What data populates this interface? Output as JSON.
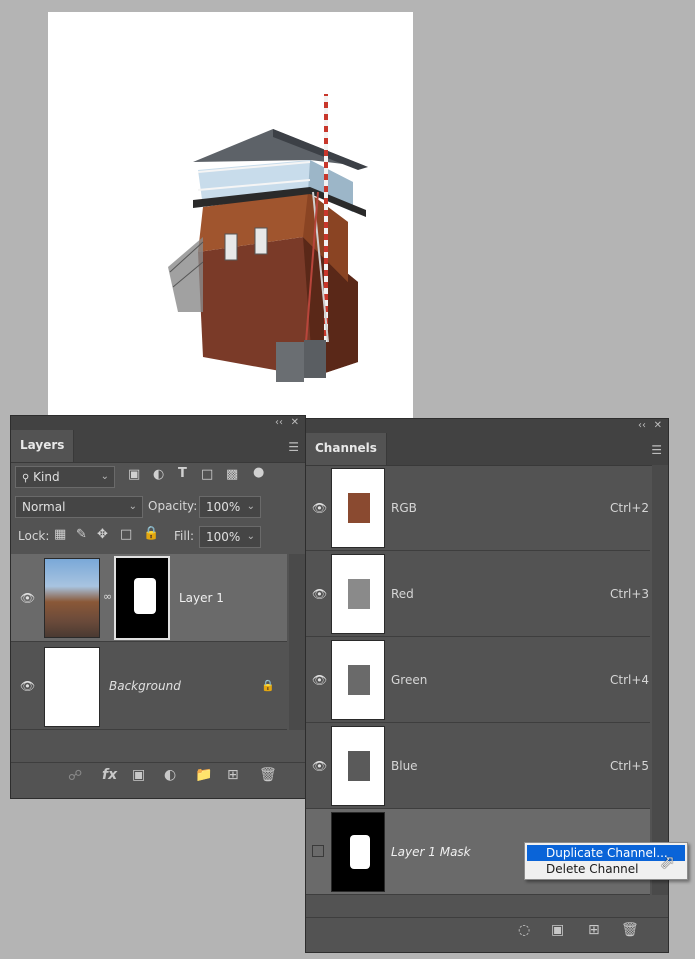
{
  "layers_panel": {
    "tab": "Layers",
    "filter_kind": "Kind",
    "blend_mode": "Normal",
    "opacity_label": "Opacity:",
    "opacity_value": "100%",
    "lock_label": "Lock:",
    "fill_label": "Fill:",
    "fill_value": "100%",
    "layers": [
      {
        "name": "Layer 1"
      },
      {
        "name": "Background"
      }
    ],
    "filter_icons": [
      "image-filter-icon",
      "adjustment-filter-icon",
      "type-filter-icon",
      "shape-filter-icon",
      "smart-object-filter-icon",
      "filter-toggle-icon"
    ],
    "footer_icons": [
      "link-icon",
      "fx-icon",
      "mask-icon",
      "adjustment-icon",
      "folder-icon",
      "new-layer-icon",
      "trash-icon"
    ]
  },
  "channels_panel": {
    "tab": "Channels",
    "channels": [
      {
        "name": "RGB",
        "shortcut": "Ctrl+2"
      },
      {
        "name": "Red",
        "shortcut": "Ctrl+3"
      },
      {
        "name": "Green",
        "shortcut": "Ctrl+4"
      },
      {
        "name": "Blue",
        "shortcut": "Ctrl+5"
      },
      {
        "name": "Layer 1 Mask",
        "shortcut": ""
      }
    ],
    "footer_icons": [
      "load-selection-icon",
      "save-selection-icon",
      "new-channel-icon",
      "trash-icon"
    ]
  },
  "context_menu": {
    "items": [
      "Duplicate Channel...",
      "Delete Channel"
    ],
    "selected_index": 0
  },
  "colors": {
    "panel_bg": "#535353",
    "selected_row": "#6a6a6a",
    "menu_highlight": "#0a64d8"
  }
}
